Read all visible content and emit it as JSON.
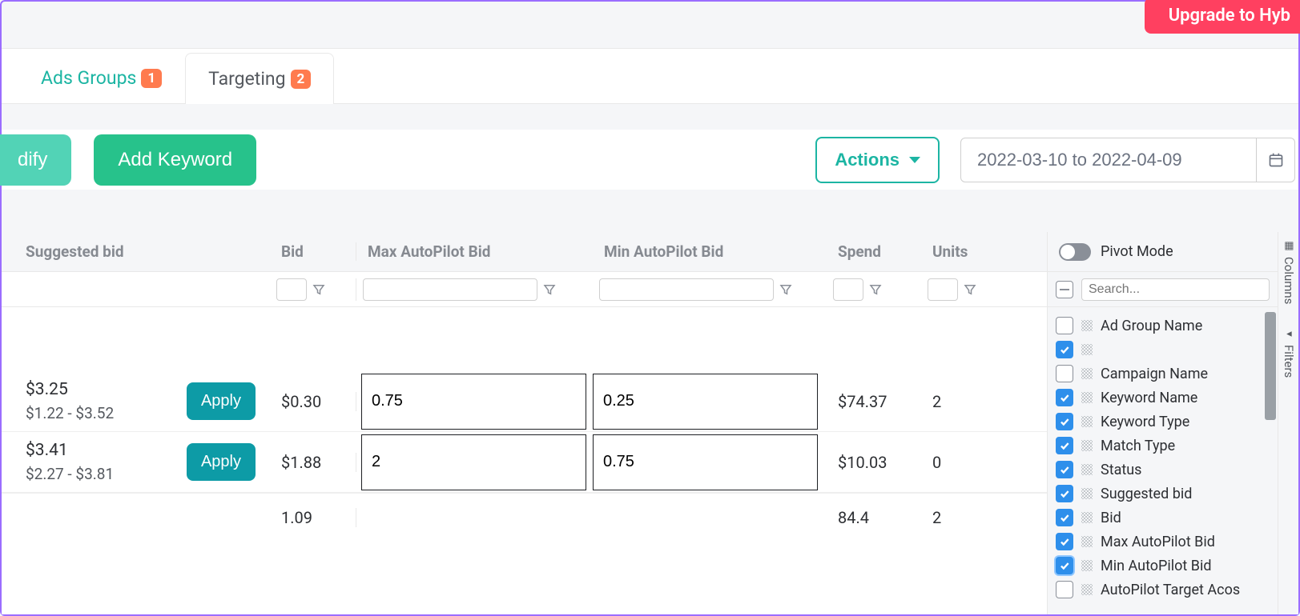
{
  "banner": {
    "upgrade_label": "Upgrade to Hyb"
  },
  "tabs": {
    "ads_groups": {
      "label": "Ads Groups",
      "count": "1"
    },
    "targeting": {
      "label": "Targeting",
      "count": "2"
    }
  },
  "toolbar": {
    "modify_label": "dify",
    "add_keyword_label": "Add Keyword",
    "actions_label": "Actions",
    "date_range": "2022-03-10 to 2022-04-09"
  },
  "grid": {
    "headers": {
      "suggested_bid": "Suggested bid",
      "bid": "Bid",
      "max_autopilot": "Max AutoPilot Bid",
      "min_autopilot": "Min AutoPilot Bid",
      "spend": "Spend",
      "units": "Units"
    },
    "rows": [
      {
        "suggested_main": "$3.25",
        "suggested_range": "$1.22 - $3.52",
        "apply_label": "Apply",
        "bid": "$0.30",
        "max_auto": "0.75",
        "min_auto": "0.25",
        "spend": "$74.37",
        "units": "2"
      },
      {
        "suggested_main": "$3.41",
        "suggested_range": "$2.27 - $3.81",
        "apply_label": "Apply",
        "bid": "$1.88",
        "max_auto": "2",
        "min_auto": "0.75",
        "spend": "$10.03",
        "units": "0"
      }
    ],
    "footer": {
      "bid": "1.09",
      "spend": "84.4",
      "units": "2"
    }
  },
  "side_panel": {
    "pivot_label": "Pivot Mode",
    "search_placeholder": "Search...",
    "columns": [
      {
        "label": "Ad Group Name",
        "checked": false
      },
      {
        "label": "",
        "checked": true
      },
      {
        "label": "Campaign Name",
        "checked": false
      },
      {
        "label": "Keyword Name",
        "checked": true
      },
      {
        "label": "Keyword Type",
        "checked": true
      },
      {
        "label": "Match Type",
        "checked": true
      },
      {
        "label": "Status",
        "checked": true
      },
      {
        "label": "Suggested bid",
        "checked": true
      },
      {
        "label": "Bid",
        "checked": true
      },
      {
        "label": "Max AutoPilot Bid",
        "checked": true
      },
      {
        "label": "Min AutoPilot Bid",
        "checked": true,
        "highlight": true
      },
      {
        "label": "AutoPilot Target Acos",
        "checked": false
      }
    ]
  },
  "side_rail": {
    "columns_label": "Columns",
    "filters_label": "Filters"
  }
}
